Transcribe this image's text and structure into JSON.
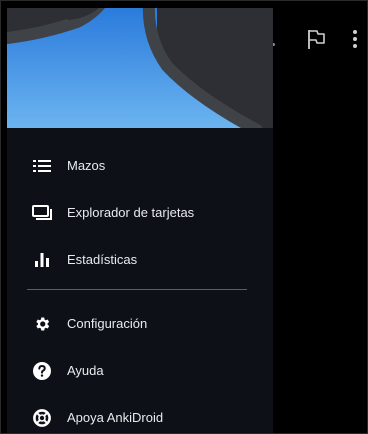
{
  "colors": {
    "drawer_bg": "#0d1117",
    "header_blue": "#3a8de0",
    "text": "#e8eaed",
    "icon": "#ffffff"
  },
  "toolbar": {
    "icons": [
      "flag-icon",
      "overflow-menu-icon"
    ]
  },
  "drawer": {
    "primary_items": [
      {
        "label": "Mazos",
        "icon": "list-icon"
      },
      {
        "label": "Explorador de tarjetas",
        "icon": "card-browser-icon"
      },
      {
        "label": "Estadísticas",
        "icon": "bar-chart-icon"
      }
    ],
    "secondary_items": [
      {
        "label": "Configuración",
        "icon": "gear-icon"
      },
      {
        "label": "Ayuda",
        "icon": "help-icon"
      },
      {
        "label": "Apoya AnkiDroid",
        "icon": "lifebuoy-icon"
      }
    ]
  }
}
